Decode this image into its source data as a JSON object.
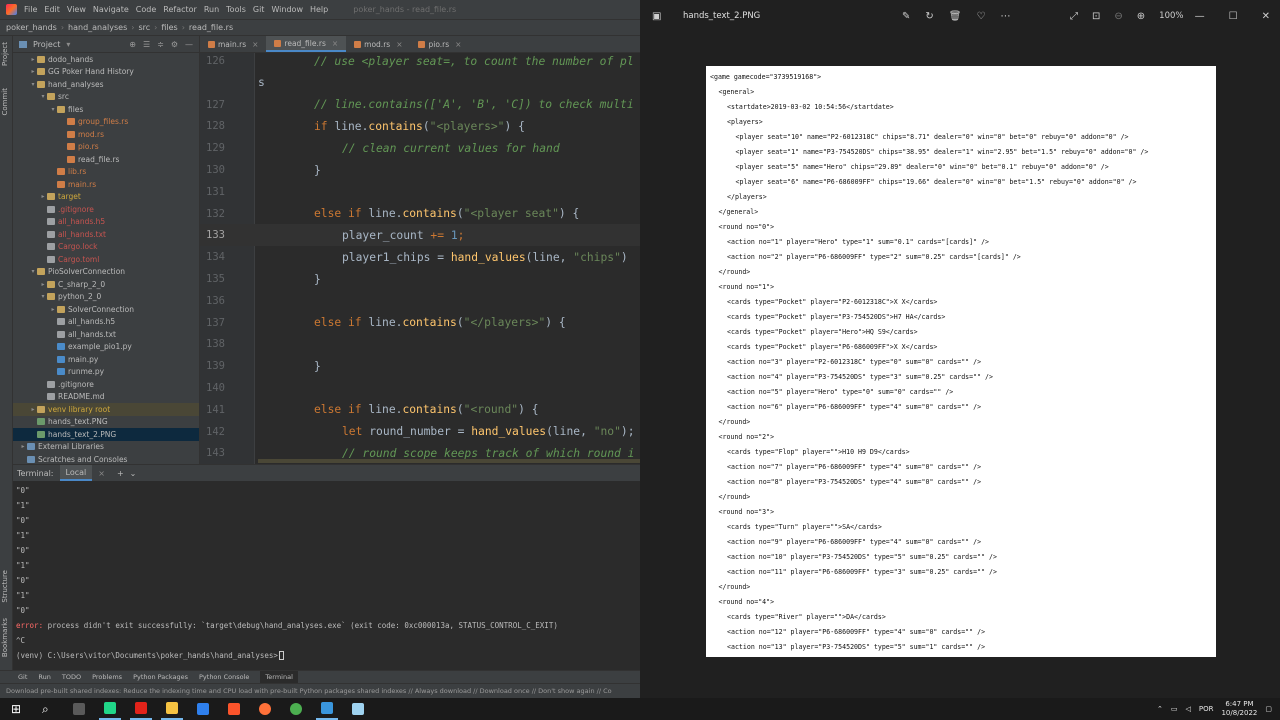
{
  "ide": {
    "menu": [
      "File",
      "Edit",
      "View",
      "Navigate",
      "Code",
      "Refactor",
      "Run",
      "Tools",
      "Git",
      "Window",
      "Help"
    ],
    "title": "poker_hands - read_file.rs",
    "breadcrumb": [
      "poker_hands",
      "hand_analyses",
      "src",
      "files",
      "read_file.rs"
    ],
    "project_label": "Project",
    "side_tabs": [
      "Project",
      "Commit"
    ],
    "side_tabs_bottom": [
      "Structure",
      "Bookmarks"
    ],
    "tree": [
      {
        "label": "dodo_hands",
        "indent": 2,
        "type": "folder",
        "arrow": "▸"
      },
      {
        "label": "GG Poker Hand History",
        "indent": 2,
        "type": "folder",
        "arrow": "▸"
      },
      {
        "label": "hand_analyses",
        "indent": 2,
        "type": "folder",
        "arrow": "▾"
      },
      {
        "label": "src",
        "indent": 3,
        "type": "folder",
        "arrow": "▾"
      },
      {
        "label": "files",
        "indent": 4,
        "type": "folder",
        "arrow": "▾"
      },
      {
        "label": "group_files.rs",
        "indent": 5,
        "type": "rs",
        "arrow": ""
      },
      {
        "label": "mod.rs",
        "indent": 5,
        "type": "rs",
        "arrow": ""
      },
      {
        "label": "pio.rs",
        "indent": 5,
        "type": "rs",
        "arrow": ""
      },
      {
        "label": "read_file.rs",
        "indent": 5,
        "type": "rs",
        "arrow": "",
        "white": true
      },
      {
        "label": "lib.rs",
        "indent": 4,
        "type": "rs",
        "arrow": ""
      },
      {
        "label": "main.rs",
        "indent": 4,
        "type": "rs",
        "arrow": ""
      },
      {
        "label": "target",
        "indent": 3,
        "type": "ex",
        "arrow": "▸"
      },
      {
        "label": ".gitignore",
        "indent": 3,
        "type": "txt",
        "arrow": ""
      },
      {
        "label": "all_hands.h5",
        "indent": 3,
        "type": "txt",
        "arrow": ""
      },
      {
        "label": "all_hands.txt",
        "indent": 3,
        "type": "txt",
        "arrow": ""
      },
      {
        "label": "Cargo.lock",
        "indent": 3,
        "type": "txt",
        "arrow": ""
      },
      {
        "label": "Cargo.toml",
        "indent": 3,
        "type": "txt",
        "arrow": ""
      },
      {
        "label": "PioSolverConnection",
        "indent": 2,
        "type": "folder",
        "arrow": "▾"
      },
      {
        "label": "C_sharp_2_0",
        "indent": 3,
        "type": "folder",
        "arrow": "▸"
      },
      {
        "label": "python_2_0",
        "indent": 3,
        "type": "folder",
        "arrow": "▾"
      },
      {
        "label": "SolverConnection",
        "indent": 4,
        "type": "folder",
        "arrow": "▸"
      },
      {
        "label": "all_hands.h5",
        "indent": 4,
        "type": "txt",
        "arrow": ""
      },
      {
        "label": "all_hands.txt",
        "indent": 4,
        "type": "txt",
        "arrow": ""
      },
      {
        "label": "example_pio1.py",
        "indent": 4,
        "type": "py",
        "arrow": ""
      },
      {
        "label": "main.py",
        "indent": 4,
        "type": "py",
        "arrow": ""
      },
      {
        "label": "runme.py",
        "indent": 4,
        "type": "py",
        "arrow": ""
      },
      {
        "label": ".gitignore",
        "indent": 3,
        "type": "txt",
        "arrow": ""
      },
      {
        "label": "README.md",
        "indent": 3,
        "type": "txt",
        "arrow": ""
      },
      {
        "label": "venv  library root",
        "indent": 2,
        "type": "ex",
        "arrow": "▸",
        "excluded": true
      },
      {
        "label": "hands_text.PNG",
        "indent": 2,
        "type": "png",
        "arrow": ""
      },
      {
        "label": "hands_text_2.PNG",
        "indent": 2,
        "type": "png",
        "arrow": "",
        "selected": true
      },
      {
        "label": "External Libraries",
        "indent": 1,
        "type": "lib",
        "arrow": "▸"
      },
      {
        "label": "Scratches and Consoles",
        "indent": 1,
        "type": "lib",
        "arrow": ""
      }
    ],
    "tabs": [
      {
        "label": "main.rs",
        "active": false
      },
      {
        "label": "read_file.rs",
        "active": true
      },
      {
        "label": "mod.rs",
        "active": false
      },
      {
        "label": "pio.rs",
        "active": false
      }
    ],
    "code": [
      {
        "ln": "126",
        "html": "<span class='cm'>// use &lt;player seat=, to count the number of pl</span>",
        "indent": 56
      },
      {
        "ln": "",
        "html": "s",
        "indent": 0
      },
      {
        "ln": "127",
        "html": "<span class='cm'>// line.contains(['A', 'B', 'C]) to check multi</span>",
        "indent": 56
      },
      {
        "ln": "128",
        "html": "<span class='kw'>if </span>line.<span class='fn'>contains</span>(<span class='st'>\"&lt;players&gt;\"</span>) {",
        "indent": 56
      },
      {
        "ln": "129",
        "html": "<span class='cm'>// clean current values for hand</span>",
        "indent": 84
      },
      {
        "ln": "130",
        "html": "}",
        "indent": 56
      },
      {
        "ln": "131",
        "html": "",
        "indent": 56
      },
      {
        "ln": "132",
        "html": "<span class='kw'>else if </span>line.<span class='fn'>contains</span>(<span class='st'>\"&lt;player seat\"</span>) {",
        "indent": 56
      },
      {
        "ln": "133",
        "html": "player_count <span class='kw'>+=</span> <span class='nm'>1</span><span class='kw'>;</span>",
        "indent": 84,
        "current": true
      },
      {
        "ln": "134",
        "html": "player1_chips = <span class='fn'>hand_values</span>(line, <span class='st'>\"chips\"</span>)",
        "indent": 84
      },
      {
        "ln": "135",
        "html": "}",
        "indent": 56
      },
      {
        "ln": "136",
        "html": "",
        "indent": 56
      },
      {
        "ln": "137",
        "html": "<span class='kw'>else if </span>line.<span class='fn'>contains</span>(<span class='st'>\"&lt;/players&gt;\"</span>) {",
        "indent": 56
      },
      {
        "ln": "138",
        "html": "",
        "indent": 56
      },
      {
        "ln": "139",
        "html": "}",
        "indent": 56
      },
      {
        "ln": "140",
        "html": "",
        "indent": 56
      },
      {
        "ln": "141",
        "html": "<span class='kw'>else if </span>line.<span class='fn'>contains</span>(<span class='st'>\"&lt;round\"</span>) {",
        "indent": 56
      },
      {
        "ln": "142",
        "html": "<span class='kw'>let </span>round_number = <span class='fn'>hand_values</span>(line, <span class='st'>\"no\"</span>);",
        "indent": 84
      },
      {
        "ln": "143",
        "html": "<span class='cm'>// round scope keeps track of which round i</span>",
        "indent": 84
      }
    ],
    "terminal_label": "Terminal:",
    "terminal_tab": "Local",
    "terminal_lines": [
      "\"0\"",
      "\"1\"",
      "\"0\"",
      "\"1\"",
      "\"0\"",
      "\"1\"",
      "\"0\"",
      "\"1\"",
      "\"0\""
    ],
    "terminal_error_tag": "error:",
    "terminal_error": " process didn't exit successfully: `target\\debug\\hand_analyses.exe` (exit code: 0xc000013a, STATUS_CONTROL_C_EXIT)",
    "terminal_ctrl": "^C",
    "terminal_prompt": "(venv) C:\\Users\\vitor\\Documents\\poker_hands\\hand_analyses>",
    "bottom_tabs": [
      "Git",
      "Run",
      "TODO",
      "Problems",
      "Python Packages",
      "Python Console",
      "Terminal"
    ],
    "status": "Download pre-built shared indexes: Reduce the indexing time and CPU load with pre-built Python packages shared indexes // Always download // Download once // Don't show again // Co"
  },
  "viewer": {
    "filename": "hands_text_2.PNG",
    "zoom": "100%",
    "xml_lines": [
      {
        "t": "<game gamecode=\"3739519168\">",
        "i": 0
      },
      {
        "t": "<general>",
        "i": 1
      },
      {
        "t": "<startdate>2019-03-02 10:54:56</startdate>",
        "i": 2
      },
      {
        "t": "<players>",
        "i": 2
      },
      {
        "t": "<player seat=\"10\" name=\"P2-6012318C\" chips=\"8.71\" dealer=\"0\" win=\"0\" bet=\"0\" rebuy=\"0\" addon=\"0\" />",
        "i": 3
      },
      {
        "t": "<player seat=\"1\" name=\"P3-754520DS\" chips=\"38.95\" dealer=\"1\" win=\"2.95\" bet=\"1.5\" rebuy=\"0\" addon=\"0\" />",
        "i": 3
      },
      {
        "t": "<player seat=\"5\" name=\"Hero\" chips=\"29.89\" dealer=\"0\" win=\"0\" bet=\"0.1\" rebuy=\"0\" addon=\"0\" />",
        "i": 3
      },
      {
        "t": "<player seat=\"6\" name=\"P6-686009FF\" chips=\"19.66\" dealer=\"0\" win=\"0\" bet=\"1.5\" rebuy=\"0\" addon=\"0\" />",
        "i": 3
      },
      {
        "t": "</players>",
        "i": 2
      },
      {
        "t": "</general>",
        "i": 1
      },
      {
        "t": "<round no=\"0\">",
        "i": 1
      },
      {
        "t": "<action no=\"1\" player=\"Hero\" type=\"1\" sum=\"0.1\" cards=\"[cards]\" />",
        "i": 2
      },
      {
        "t": "<action no=\"2\" player=\"P6-686009FF\" type=\"2\" sum=\"0.25\" cards=\"[cards]\" />",
        "i": 2
      },
      {
        "t": "</round>",
        "i": 1
      },
      {
        "t": "<round no=\"1\">",
        "i": 1
      },
      {
        "t": "<cards type=\"Pocket\" player=\"P2-6012318C\">X X</cards>",
        "i": 2
      },
      {
        "t": "<cards type=\"Pocket\" player=\"P3-754520DS\">H7 HA</cards>",
        "i": 2
      },
      {
        "t": "<cards type=\"Pocket\" player=\"Hero\">HQ S9</cards>",
        "i": 2
      },
      {
        "t": "<cards type=\"Pocket\" player=\"P6-686009FF\">X X</cards>",
        "i": 2
      },
      {
        "t": "<action no=\"3\" player=\"P2-6012318C\" type=\"0\" sum=\"0\" cards=\"\" />",
        "i": 2
      },
      {
        "t": "<action no=\"4\" player=\"P3-754520DS\" type=\"3\" sum=\"0.25\" cards=\"\" />",
        "i": 2
      },
      {
        "t": "<action no=\"5\" player=\"Hero\" type=\"0\" sum=\"0\" cards=\"\" />",
        "i": 2
      },
      {
        "t": "<action no=\"6\" player=\"P6-686009FF\" type=\"4\" sum=\"0\" cards=\"\" />",
        "i": 2
      },
      {
        "t": "</round>",
        "i": 1
      },
      {
        "t": "<round no=\"2\">",
        "i": 1
      },
      {
        "t": "<cards type=\"Flop\" player=\"\">H10 H9 D9</cards>",
        "i": 2
      },
      {
        "t": "<action no=\"7\" player=\"P6-686009FF\" type=\"4\" sum=\"0\" cards=\"\" />",
        "i": 2
      },
      {
        "t": "<action no=\"8\" player=\"P3-754520DS\" type=\"4\" sum=\"0\" cards=\"\" />",
        "i": 2
      },
      {
        "t": "</round>",
        "i": 1
      },
      {
        "t": "<round no=\"3\">",
        "i": 1
      },
      {
        "t": "<cards type=\"Turn\" player=\"\">SA</cards>",
        "i": 2
      },
      {
        "t": "<action no=\"9\" player=\"P6-686009FF\" type=\"4\" sum=\"0\" cards=\"\" />",
        "i": 2
      },
      {
        "t": "<action no=\"10\" player=\"P3-754520DS\" type=\"5\" sum=\"0.25\" cards=\"\" />",
        "i": 2
      },
      {
        "t": "<action no=\"11\" player=\"P6-686009FF\" type=\"3\" sum=\"0.25\" cards=\"\" />",
        "i": 2
      },
      {
        "t": "</round>",
        "i": 1
      },
      {
        "t": "<round no=\"4\">",
        "i": 1
      },
      {
        "t": "<cards type=\"River\" player=\"\">DA</cards>",
        "i": 2
      },
      {
        "t": "<action no=\"12\" player=\"P6-686009FF\" type=\"4\" sum=\"0\" cards=\"\" />",
        "i": 2
      },
      {
        "t": "<action no=\"13\" player=\"P3-754520DS\" type=\"5\" sum=\"1\" cards=\"\" />",
        "i": 2
      }
    ]
  },
  "taskbar": {
    "lang": "POR",
    "time": "6:47 PM",
    "date": "10/8/2022",
    "apps": [
      {
        "name": "windows-start-icon",
        "color": "#ffffff",
        "active": false
      },
      {
        "name": "search-icon",
        "color": "#ffffff",
        "active": false
      },
      {
        "name": "task-app-icon",
        "color": "#5a5a5a",
        "active": false
      },
      {
        "name": "pycharm-icon",
        "color": "#21d789",
        "active": true
      },
      {
        "name": "app-red-icon",
        "color": "#e2231a",
        "active": true
      },
      {
        "name": "file-explorer-icon",
        "color": "#f5c242",
        "active": true
      },
      {
        "name": "vscode-icon",
        "color": "#2f80ed",
        "active": false
      },
      {
        "name": "brave-icon",
        "color": "#fb542b",
        "active": false
      },
      {
        "name": "firefox-icon",
        "color": "#ff7139",
        "active": false
      },
      {
        "name": "chrome-icon",
        "color": "#4caf50",
        "active": false
      },
      {
        "name": "photos-icon",
        "color": "#3a96dd",
        "active": true
      },
      {
        "name": "app-light-icon",
        "color": "#9fd3f0",
        "active": false
      }
    ]
  }
}
